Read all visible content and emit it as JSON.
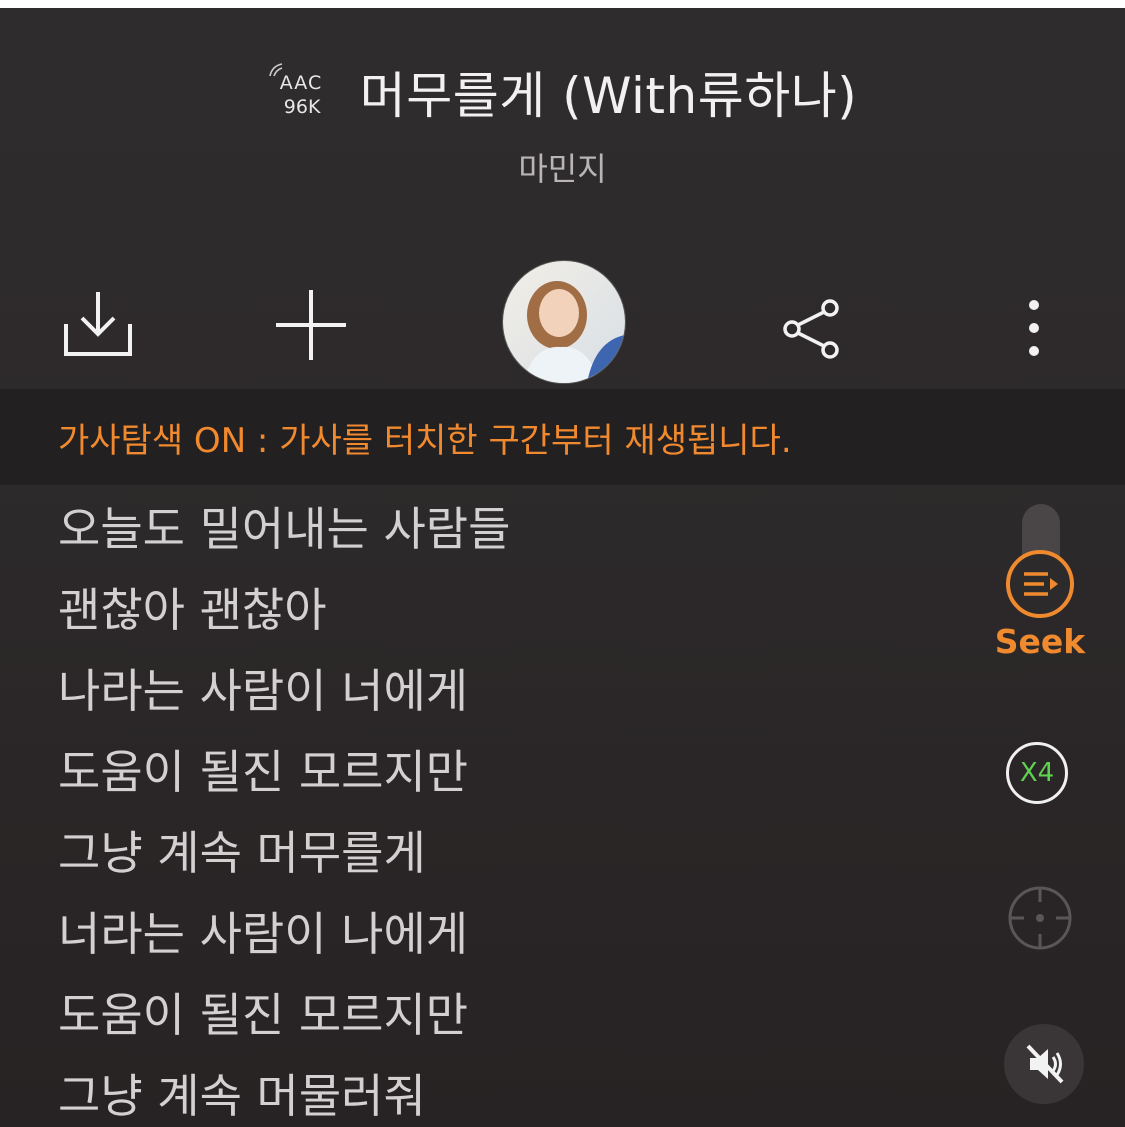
{
  "header": {
    "codec_top": "AAC",
    "codec_bottom": "96K",
    "song_title": "머무를게 (With류하나)",
    "artist": "마민지"
  },
  "toolbar": {
    "icons": [
      "download-icon",
      "add-icon",
      "album-art-avatar",
      "share-icon",
      "more-vertical-icon"
    ]
  },
  "notice": {
    "text": "가사탐색 ON : 가사를 터치한 구간부터 재생됩니다."
  },
  "lyrics": [
    "오늘도 밀어내는 사람들",
    "괜찮아 괜찮아",
    "나라는 사람이 너에게",
    "도움이 될진 모르지만",
    "그냥 계속 머무를게",
    "너라는 사람이 나에게",
    "도움이 될진 모르지만",
    "그냥 계속 머물러줘"
  ],
  "side_controls": {
    "seek_label": "Seek",
    "speed_label": "X4",
    "accent_color": "#f08a2e",
    "speed_color": "#5ed151"
  }
}
